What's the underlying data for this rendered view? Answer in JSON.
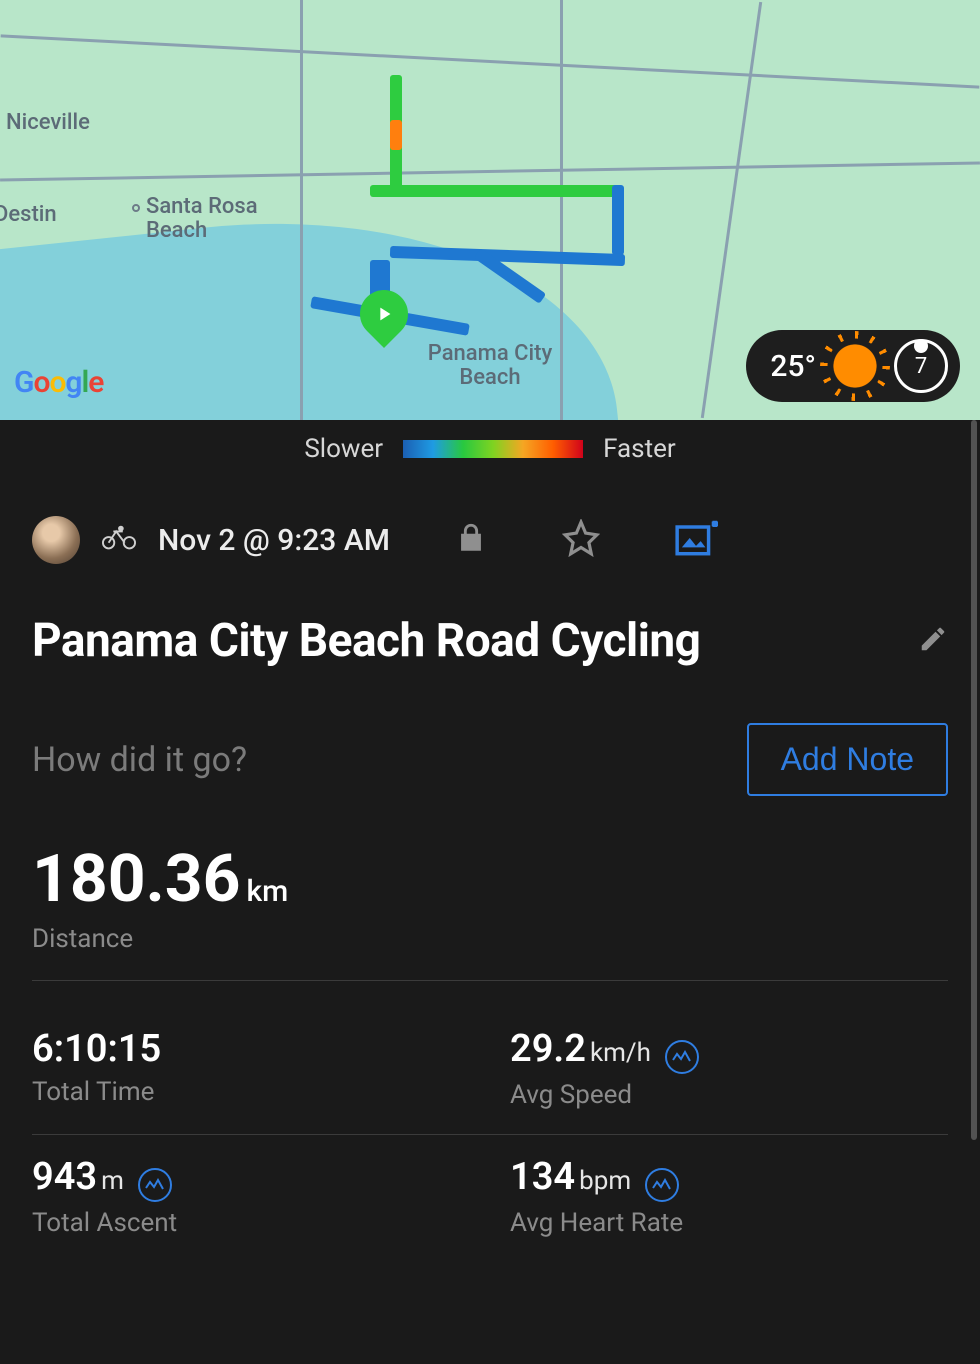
{
  "map": {
    "places": {
      "niceville": "Niceville",
      "destin": "Destin",
      "santa_rosa": "Santa Rosa Beach",
      "pcb": "Panama City Beach"
    },
    "google_logo": "Google",
    "weather": {
      "temp": "25°",
      "uv": "7"
    }
  },
  "legend": {
    "slower": "Slower",
    "faster": "Faster"
  },
  "activity": {
    "timestamp": "Nov 2 @ 9:23 AM",
    "title": "Panama City Beach Road Cycling",
    "note_prompt": "How did it go?",
    "add_note": "Add Note",
    "distance": {
      "value": "180.36",
      "unit": "km",
      "label": "Distance"
    },
    "total_time": {
      "value": "6:10:15",
      "label": "Total Time"
    },
    "avg_speed": {
      "value": "29.2",
      "unit": "km/h",
      "label": "Avg Speed"
    },
    "total_ascent": {
      "value": "943",
      "unit": "m",
      "label": "Total Ascent"
    },
    "avg_hr": {
      "value": "134",
      "unit": "bpm",
      "label": "Avg Heart Rate"
    }
  }
}
